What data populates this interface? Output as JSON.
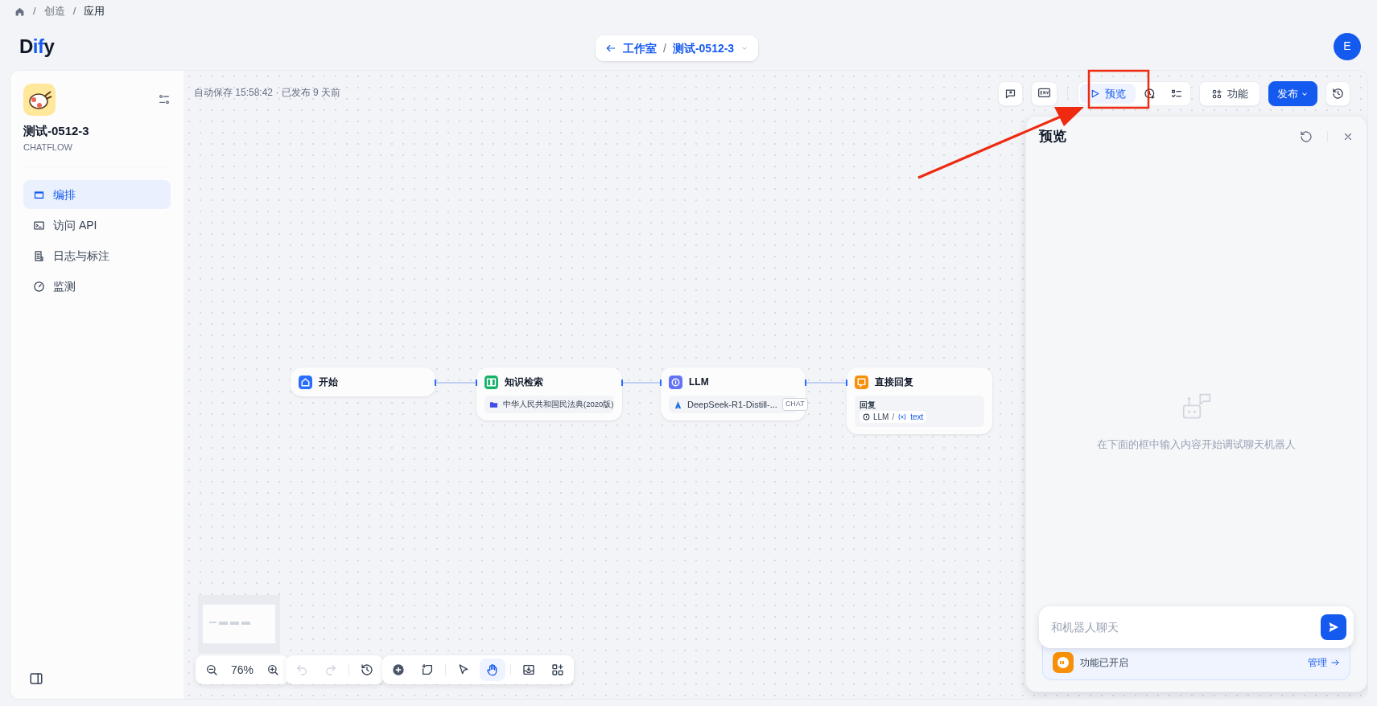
{
  "breadcrumb": [
    {
      "separator": "/",
      "label": "创造",
      "current": false
    },
    {
      "separator": "/",
      "label": "应用",
      "current": true
    }
  ],
  "header": {
    "logo": [
      {
        "text": "D",
        "accent": false
      },
      {
        "text": "if",
        "accent": true
      },
      {
        "text": "y",
        "accent": false
      }
    ],
    "back_label": "工作室",
    "separator": "/",
    "app_name": "测试-0512-3",
    "avatar": "E"
  },
  "sidebar": {
    "app_name": "测试-0512-3",
    "app_type": "CHATFLOW",
    "items": [
      {
        "label": "编排",
        "selected": true
      },
      {
        "label": "访问 API",
        "selected": false
      },
      {
        "label": "日志与标注",
        "selected": false
      },
      {
        "label": "监测",
        "selected": false
      }
    ]
  },
  "canvas": {
    "status": "自动保存 15:58:42 · 已发布 9 天前",
    "toolbar": {
      "preview": {
        "label": "预览",
        "selected": true
      },
      "features": "功能",
      "publish": "发布"
    },
    "nodes": [
      {
        "kind": "start",
        "title": "开始",
        "color": "#296dff"
      },
      {
        "kind": "knowledge",
        "title": "知识检索",
        "color": "#17b26a",
        "dataset": "中华人民共和国民法典(2020版)"
      },
      {
        "kind": "llm",
        "title": "LLM",
        "color": "#6172f3",
        "model": "DeepSeek-R1-Distill-...",
        "mode": "CHAT"
      },
      {
        "kind": "answer",
        "title": "直接回复",
        "color": "#f79009",
        "field": "回复",
        "source": "LLM",
        "separator": "/",
        "variable": "text"
      }
    ],
    "zoom": "76%",
    "history": {
      "undo_disabled": true,
      "redo_disabled": true
    },
    "modes": [
      {
        "selected": false
      },
      {
        "selected": true
      }
    ]
  },
  "preview": {
    "title": "预览",
    "empty_text": "在下面的框中输入内容开始调试聊天机器人",
    "input": {
      "placeholder": "和机器人聊天"
    },
    "features_status": "功能已开启",
    "manage": "管理"
  }
}
